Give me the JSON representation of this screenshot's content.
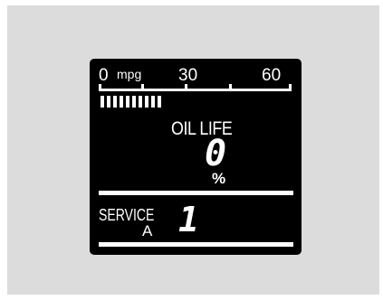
{
  "mpg_scale": {
    "min_label": "0",
    "unit_label": "mpg",
    "mid_label": "30",
    "max_label": "60"
  },
  "mpg_bar": {
    "segments_lit": 10
  },
  "oil_life": {
    "label": "OIL LIFE",
    "value": "0",
    "unit": "%"
  },
  "service": {
    "label": "SERVICE",
    "main_code": "A",
    "sub_code": "1"
  },
  "colors": {
    "display_bg": "#000000",
    "segment": "#ffffff",
    "panel_bg": "#dcdcdc"
  }
}
